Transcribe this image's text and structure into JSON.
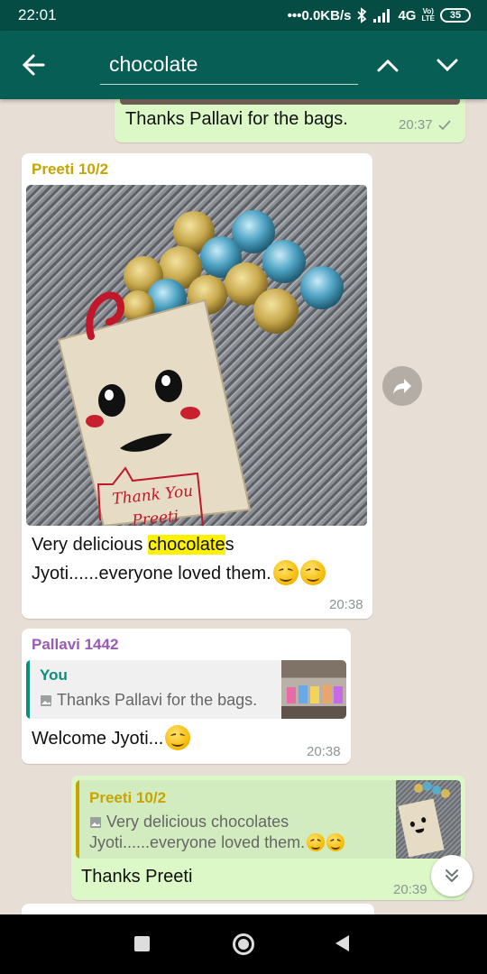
{
  "status_bar": {
    "time": "22:01",
    "network_speed": "0.0KB/s",
    "network": "4G",
    "volte_top": "Vo)",
    "volte_bottom": "LTE",
    "battery": "35"
  },
  "app_bar": {
    "back_icon": "arrow-left-icon",
    "search_text": "chocolate",
    "up_icon": "chevron-up-icon",
    "down_icon": "chevron-down-icon"
  },
  "colors": {
    "header": "#075e54",
    "status_bar": "#054d44",
    "outgoing_bubble": "#dcf8c6",
    "preeti_name": "#c9a400",
    "pallavi_name": "#9a5bb5",
    "you_name": "#0a8f7a",
    "highlight": "#fff200"
  },
  "messages": [
    {
      "direction": "out",
      "text": "Thanks Pallavi for the bags.",
      "time": "20:37",
      "status_icon": "check-icon"
    },
    {
      "direction": "in",
      "sender": "Preeti 10/2",
      "image": "chocolates-photo",
      "image_caption_text_top": "Thank You",
      "image_caption_text_bottom": "Preeti",
      "text_before": "Very delicious ",
      "text_highlight": "chocolate",
      "text_after": "s",
      "text_line2": "Jyoti......everyone loved them.",
      "time": "20:38"
    },
    {
      "direction": "in",
      "sender": "Pallavi 1442",
      "quote_sender": "You",
      "quote_text": "Thanks Pallavi for the bags.",
      "text": "Welcome Jyoti...",
      "time": "20:38"
    },
    {
      "direction": "out",
      "quote_sender": "Preeti 10/2",
      "quote_text_line1": "Very delicious chocolates",
      "quote_text_line2": "Jyoti......everyone loved them.",
      "text": "Thanks Preeti",
      "time": "20:39"
    }
  ],
  "floating": {
    "forward_icon": "forward-arrow-icon",
    "scroll_down_icon": "double-chevron-down-icon"
  },
  "nav_bar": {
    "recent_icon": "square-icon",
    "home_icon": "circle-icon",
    "back_icon": "triangle-back-icon"
  }
}
